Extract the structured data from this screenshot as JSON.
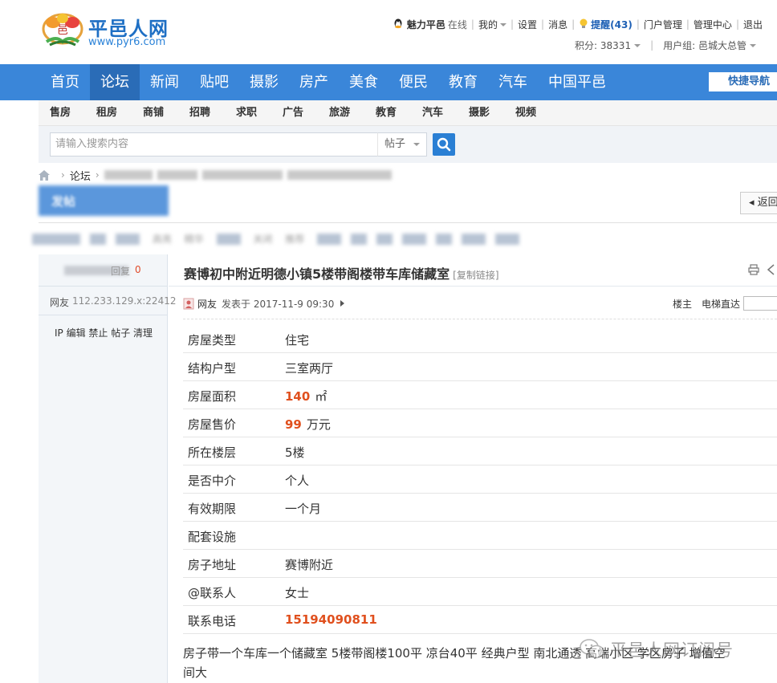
{
  "site": {
    "title": "平邑人网",
    "url": "www.pyr6.com"
  },
  "topbar": {
    "username": "魅力平邑",
    "status": "在线",
    "mine": "我的",
    "settings": "设置",
    "messages": "消息",
    "remind": "提醒(43)",
    "portal_admin": "门户管理",
    "admin_center": "管理中心",
    "logout": "退出",
    "points": "积分: 38331",
    "user_group": "用户组: 邑城大总管"
  },
  "mainnav": {
    "items": [
      "首页",
      "论坛",
      "新闻",
      "贴吧",
      "摄影",
      "房产",
      "美食",
      "便民",
      "教育",
      "汽车",
      "中国平邑"
    ],
    "quick_nav": "快捷导航"
  },
  "subnav": {
    "items": [
      "售房",
      "租房",
      "商铺",
      "招聘",
      "求职",
      "广告",
      "旅游",
      "教育",
      "汽车",
      "摄影",
      "视频"
    ]
  },
  "search": {
    "placeholder": "请输入搜索内容",
    "type": "帖子"
  },
  "breadcrumb": {
    "forum": "论坛"
  },
  "actions": {
    "post": "发帖",
    "back": "返回"
  },
  "strip": {
    "t1": "高亮",
    "t2": "精华",
    "t3": "关闭",
    "t4": "推荐"
  },
  "sidebar": {
    "replies": "回复",
    "reply_count": "0",
    "author": "网友",
    "ip": "112.233.129.x:22412",
    "admin_actions": "IP 编辑 禁止 帖子 清理"
  },
  "post": {
    "title": "赛博初中附近明德小镇5楼带阁楼带车库储藏室",
    "copy_link": "[复制链接]",
    "author": "网友",
    "posted_at": "发表于 2017-11-9 09:30",
    "floor_label": "楼主",
    "jump_label": "电梯直达"
  },
  "house_info": [
    {
      "key": "房屋类型",
      "value": "住宅"
    },
    {
      "key": "结构户型",
      "value": "三室两厅"
    },
    {
      "key": "房屋面积",
      "value": "140",
      "unit": "㎡"
    },
    {
      "key": "房屋售价",
      "value": "99",
      "unit": "万元"
    },
    {
      "key": "所在楼层",
      "value": "5楼"
    },
    {
      "key": "是否中介",
      "value": "个人"
    },
    {
      "key": "有效期限",
      "value": "一个月"
    },
    {
      "key": "配套设施",
      "value": ""
    },
    {
      "key": "房子地址",
      "value": "赛博附近"
    },
    {
      "key": "@联系人",
      "value": "女士"
    },
    {
      "key": "联系电话",
      "value": "15194090811"
    }
  ],
  "description": {
    "line1": "房子带一个车库一个储藏室  5楼带阁楼100平  凉台40平  经典户型  南北通透  高端小区  学区房子  增值空",
    "line2": "间大"
  },
  "watermark": {
    "text": "平邑人网订阅号"
  },
  "colors": {
    "nav_blue": "#3a86d9",
    "nav_active": "#2a6cb7",
    "highlight_orange": "#e0501e"
  }
}
